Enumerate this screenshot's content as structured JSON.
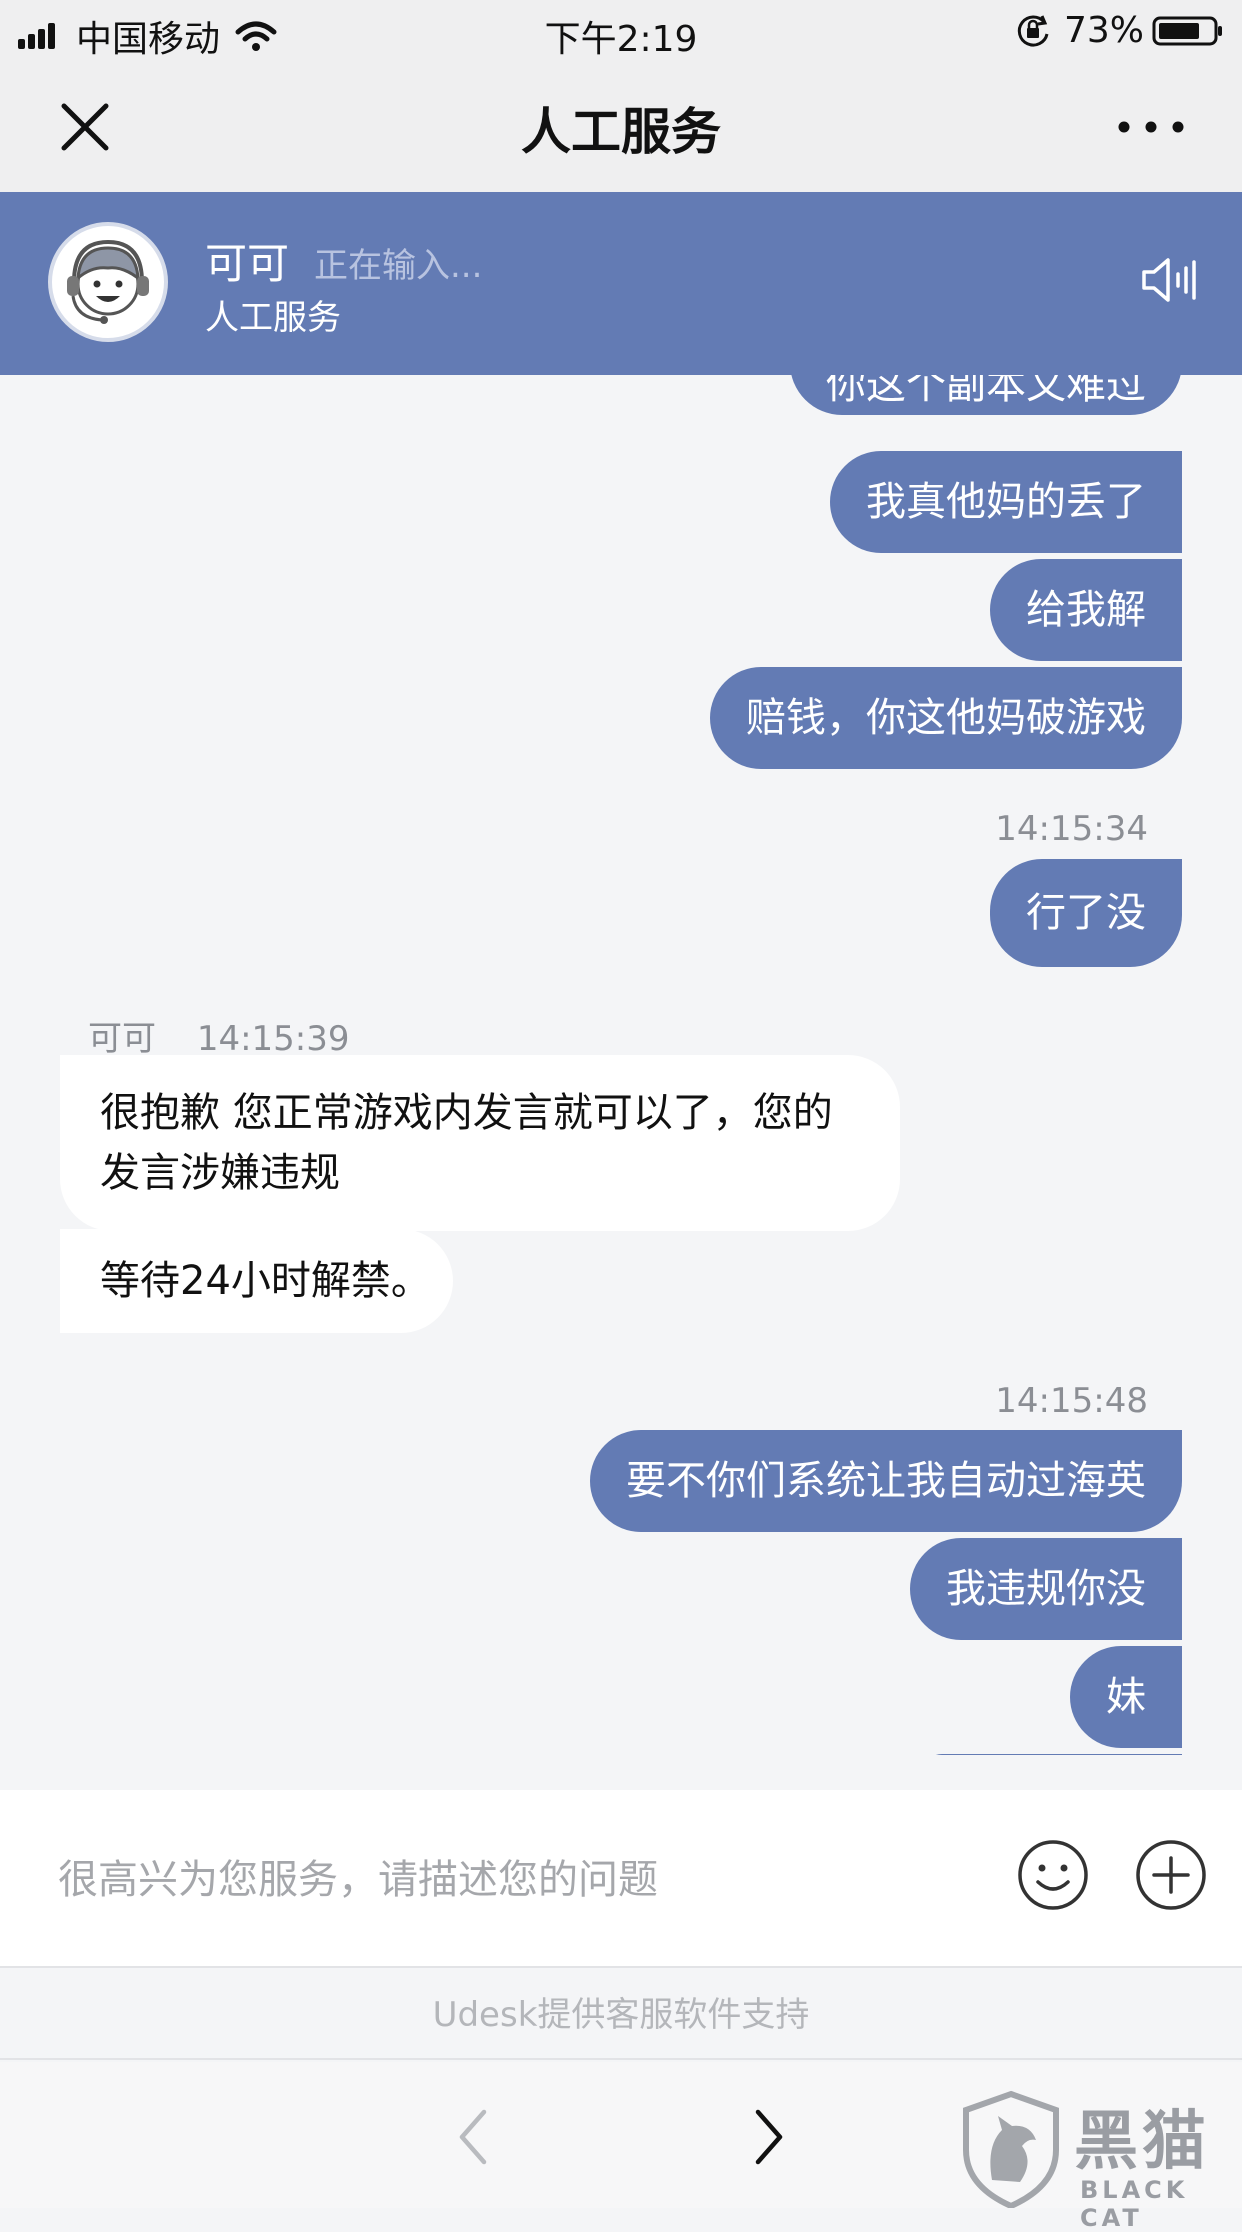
{
  "status_bar": {
    "carrier": "中国移动",
    "time": "下午2:19",
    "battery": "73%"
  },
  "nav": {
    "title": "人工服务",
    "close_icon": "close-icon",
    "more_icon": "more-icon"
  },
  "agent": {
    "name": "可可",
    "typing": "正在输入...",
    "subtitle": "人工服务",
    "speaker_icon": "speaker-icon"
  },
  "messages": [
    {
      "dir": "out",
      "text": "你这个副本又难过"
    },
    {
      "dir": "out",
      "text": "我真他妈的丢了"
    },
    {
      "dir": "out",
      "text": "给我解"
    },
    {
      "dir": "out",
      "text": "赔钱，你这他妈破游戏"
    },
    {
      "timestamp": "14:15:34"
    },
    {
      "dir": "out",
      "text": "行了没"
    },
    {
      "sender": "可可",
      "timestamp": "14:15:39"
    },
    {
      "dir": "in",
      "text": "很抱歉 您正常游戏内发言就可以了，您的发言涉嫌违规"
    },
    {
      "dir": "in",
      "text": "等待24小时解禁。"
    },
    {
      "timestamp": "14:15:48"
    },
    {
      "dir": "out",
      "text": "要不你们系统让我自动过海英"
    },
    {
      "dir": "out",
      "text": "我违规你没"
    },
    {
      "dir": "out",
      "text": "妹"
    }
  ],
  "input": {
    "placeholder": "很高兴为您服务，请描述您的问题",
    "value": ""
  },
  "support_text": "Udesk提供客服软件支持",
  "watermark": {
    "text": "黑猫",
    "sub": "BLACK CAT"
  },
  "colors": {
    "accent": "#637bb4",
    "background": "#f4f5f7"
  }
}
